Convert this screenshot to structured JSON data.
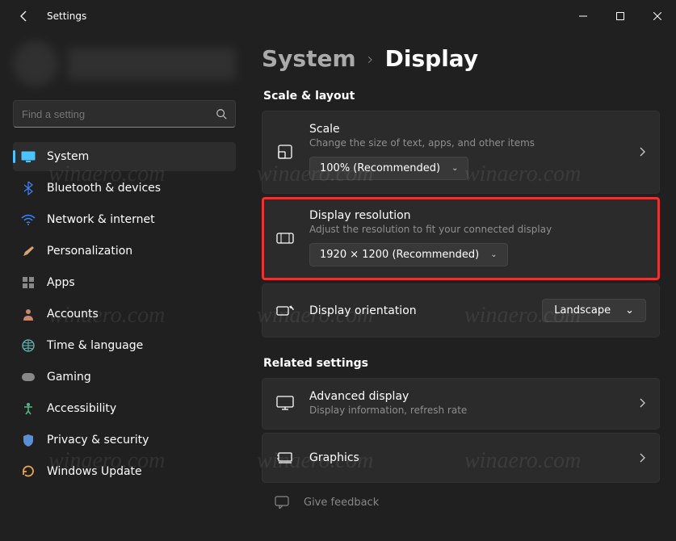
{
  "window": {
    "title": "Settings"
  },
  "search": {
    "placeholder": "Find a setting"
  },
  "nav": [
    {
      "label": "System",
      "icon": "display-icon",
      "active": true
    },
    {
      "label": "Bluetooth & devices",
      "icon": "bluetooth-icon"
    },
    {
      "label": "Network & internet",
      "icon": "wifi-icon"
    },
    {
      "label": "Personalization",
      "icon": "brush-icon"
    },
    {
      "label": "Apps",
      "icon": "apps-icon"
    },
    {
      "label": "Accounts",
      "icon": "person-icon"
    },
    {
      "label": "Time & language",
      "icon": "globe-icon"
    },
    {
      "label": "Gaming",
      "icon": "game-icon"
    },
    {
      "label": "Accessibility",
      "icon": "accessibility-icon"
    },
    {
      "label": "Privacy & security",
      "icon": "shield-icon"
    },
    {
      "label": "Windows Update",
      "icon": "update-icon"
    }
  ],
  "breadcrumb": {
    "parent": "System",
    "current": "Display"
  },
  "sections": {
    "scale_layout": {
      "heading": "Scale & layout",
      "scale": {
        "title": "Scale",
        "desc": "Change the size of text, apps, and other items",
        "value": "100% (Recommended)"
      },
      "resolution": {
        "title": "Display resolution",
        "desc": "Adjust the resolution to fit your connected display",
        "value": "1920 × 1200 (Recommended)"
      },
      "orientation": {
        "title": "Display orientation",
        "value": "Landscape"
      }
    },
    "related": {
      "heading": "Related settings",
      "advanced": {
        "title": "Advanced display",
        "desc": "Display information, refresh rate"
      },
      "graphics": {
        "title": "Graphics"
      },
      "feedback": {
        "label": "Give feedback"
      }
    }
  },
  "watermark": "winaero.com"
}
